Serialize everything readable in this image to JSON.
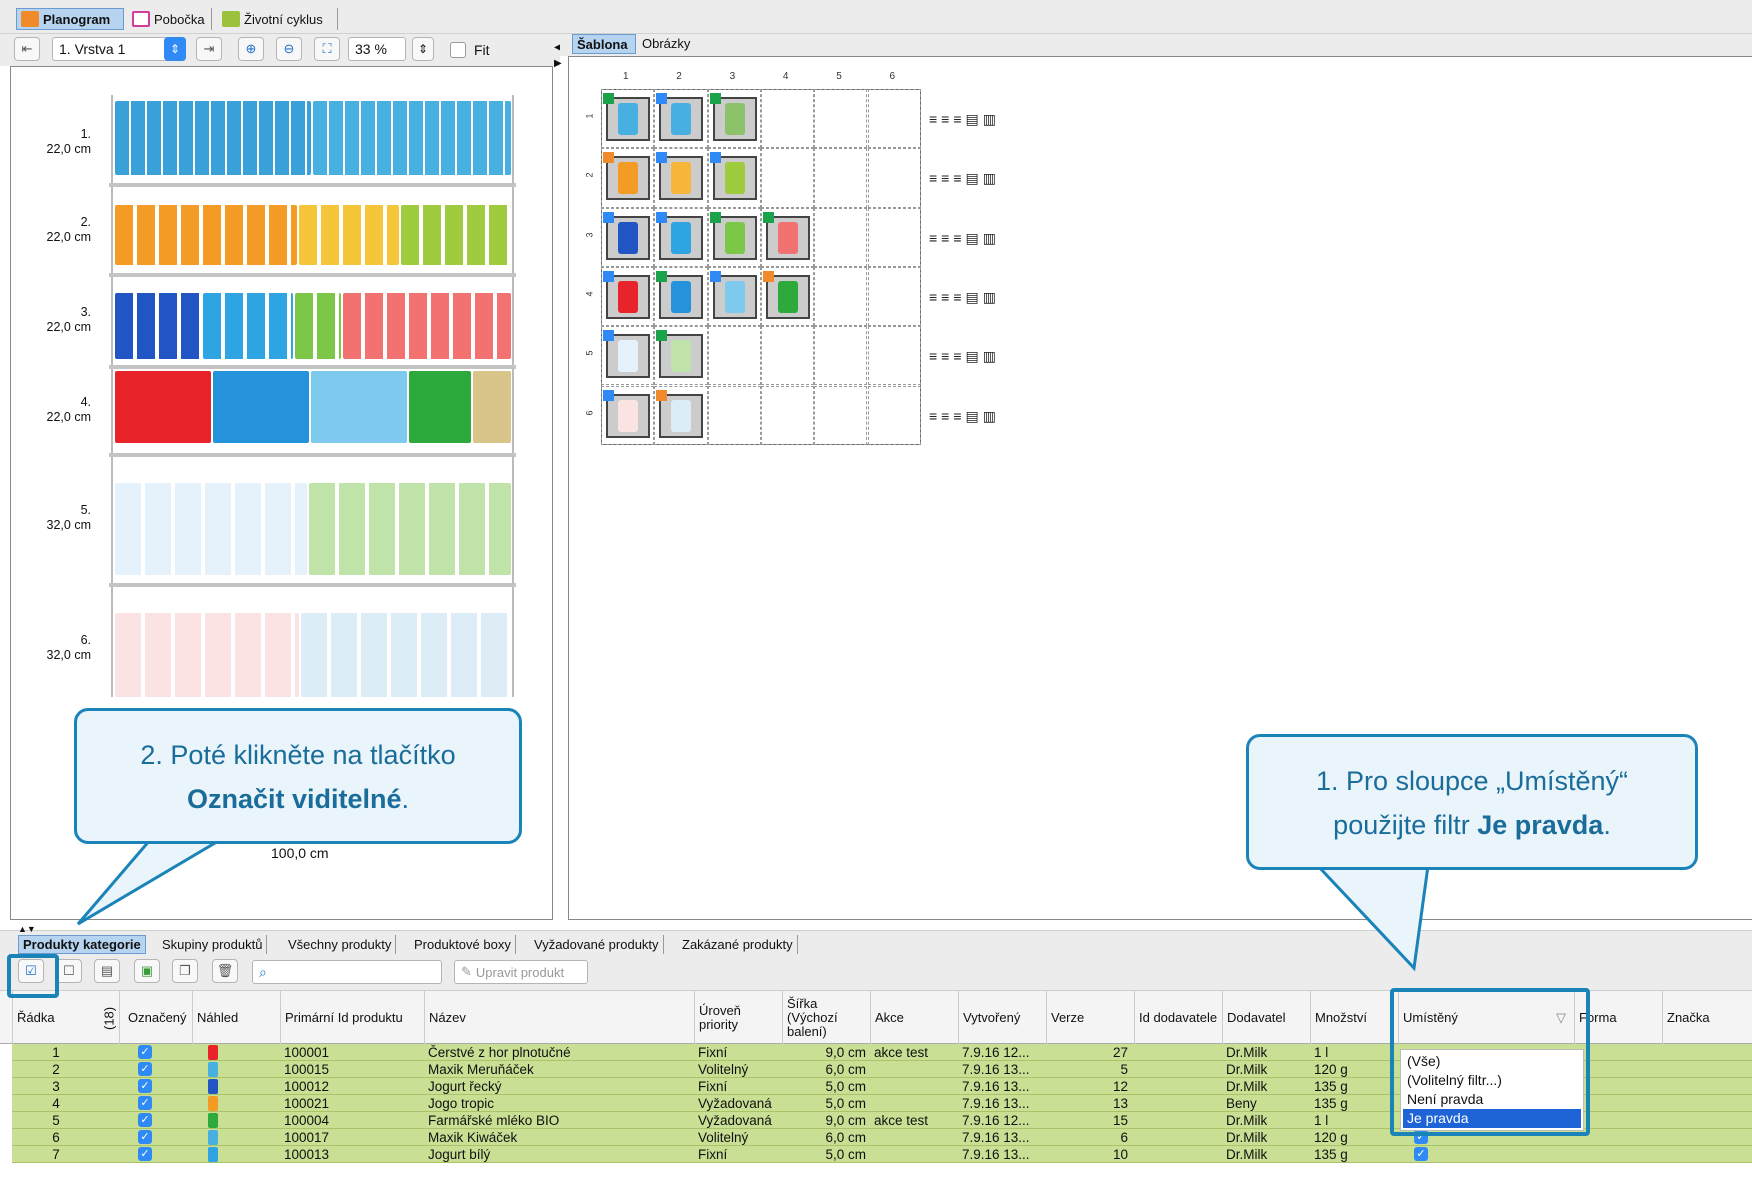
{
  "topTabs": {
    "planogram": "Planogram",
    "branch": "Pobočka",
    "lifecycle": "Životní cyklus"
  },
  "toolbar": {
    "layer": "1. Vrstva 1",
    "zoom": "33 %",
    "fit": "Fit"
  },
  "shelves": [
    {
      "num": "1.",
      "height": "22,0 cm"
    },
    {
      "num": "2.",
      "height": "22,0 cm"
    },
    {
      "num": "3.",
      "height": "22,0 cm"
    },
    {
      "num": "4.",
      "height": "22,0 cm"
    },
    {
      "num": "5.",
      "height": "32,0 cm"
    },
    {
      "num": "6.",
      "height": "32,0 cm"
    }
  ],
  "planWidth": "100,0 cm",
  "rightTabs": {
    "template": "Šablona",
    "images": "Obrázky"
  },
  "gridCols": [
    "1",
    "2",
    "3",
    "4",
    "5",
    "6"
  ],
  "gridRows": [
    "1",
    "2",
    "3",
    "4",
    "5",
    "6"
  ],
  "bottomTabs": [
    "Produkty kategorie",
    "Skupiny produktů",
    "Všechny produkty",
    "Produktové boxy",
    "Vyžadované produkty",
    "Zakázané produkty"
  ],
  "editProduct": "Upravit produkt",
  "table": {
    "headers": {
      "row": "Řádka",
      "countMark": "(18)",
      "marked": "Označený",
      "preview": "Náhled",
      "primaryId": "Primární Id produktu",
      "name": "Název",
      "priority": "Úroveň priority",
      "width": "Šířka (Výchozí balení)",
      "action": "Akce",
      "created": "Vytvořený",
      "version": "Verze",
      "supplierId": "Id dodavatele",
      "supplier": "Dodavatel",
      "quantity": "Množství",
      "placed": "Umístěný",
      "form": "Forma",
      "brand": "Značka"
    },
    "rows": [
      {
        "row": "1",
        "id": "100001",
        "name": "Čerstvé z hor plnotučné",
        "priority": "Fixní",
        "width": "9,0 cm",
        "action": "akce test",
        "created": "7.9.16 12...",
        "version": "27",
        "supplier": "Dr.Milk",
        "qty": "1 l"
      },
      {
        "row": "2",
        "id": "100015",
        "name": "Maxik Meruňáček",
        "priority": "Volitelný",
        "width": "6,0 cm",
        "action": "",
        "created": "7.9.16 13...",
        "version": "5",
        "supplier": "Dr.Milk",
        "qty": "120 g"
      },
      {
        "row": "3",
        "id": "100012",
        "name": "Jogurt řecký",
        "priority": "Fixní",
        "width": "5,0 cm",
        "action": "",
        "created": "7.9.16 13...",
        "version": "12",
        "supplier": "Dr.Milk",
        "qty": "135 g"
      },
      {
        "row": "4",
        "id": "100021",
        "name": "Jogo tropic",
        "priority": "Vyžadovaná",
        "width": "5,0 cm",
        "action": "",
        "created": "7.9.16 13...",
        "version": "13",
        "supplier": "Beny",
        "qty": "135 g"
      },
      {
        "row": "5",
        "id": "100004",
        "name": "Farmářské mléko BIO",
        "priority": "Vyžadovaná",
        "width": "9,0 cm",
        "action": "akce test",
        "created": "7.9.16 12...",
        "version": "15",
        "supplier": "Dr.Milk",
        "qty": "1 l"
      },
      {
        "row": "6",
        "id": "100017",
        "name": "Maxik Kiwáček",
        "priority": "Volitelný",
        "width": "6,0 cm",
        "action": "",
        "created": "7.9.16 13...",
        "version": "6",
        "supplier": "Dr.Milk",
        "qty": "120 g"
      },
      {
        "row": "7",
        "id": "100013",
        "name": "Jogurt bílý",
        "priority": "Fixní",
        "width": "5,0 cm",
        "action": "",
        "created": "7.9.16 13...",
        "version": "10",
        "supplier": "Dr.Milk",
        "qty": "135 g"
      }
    ]
  },
  "filterOptions": [
    "(Vše)",
    "(Volitelný filtr...)",
    "Není pravda",
    "Je pravda"
  ],
  "callout1": {
    "line1": "1. Pro sloupce „Umístěný“",
    "line2a": "použijte filtr ",
    "line2b": "Je pravda",
    "line2c": "."
  },
  "callout2": {
    "line1": "2. Poté klikněte na tlačítko",
    "line2b": "Označit viditelné",
    "line2c": "."
  },
  "colors": {
    "rowGreen": "#c9df94",
    "accentBlue": "#1a83b8",
    "selectBlue": "#1f64d6"
  }
}
